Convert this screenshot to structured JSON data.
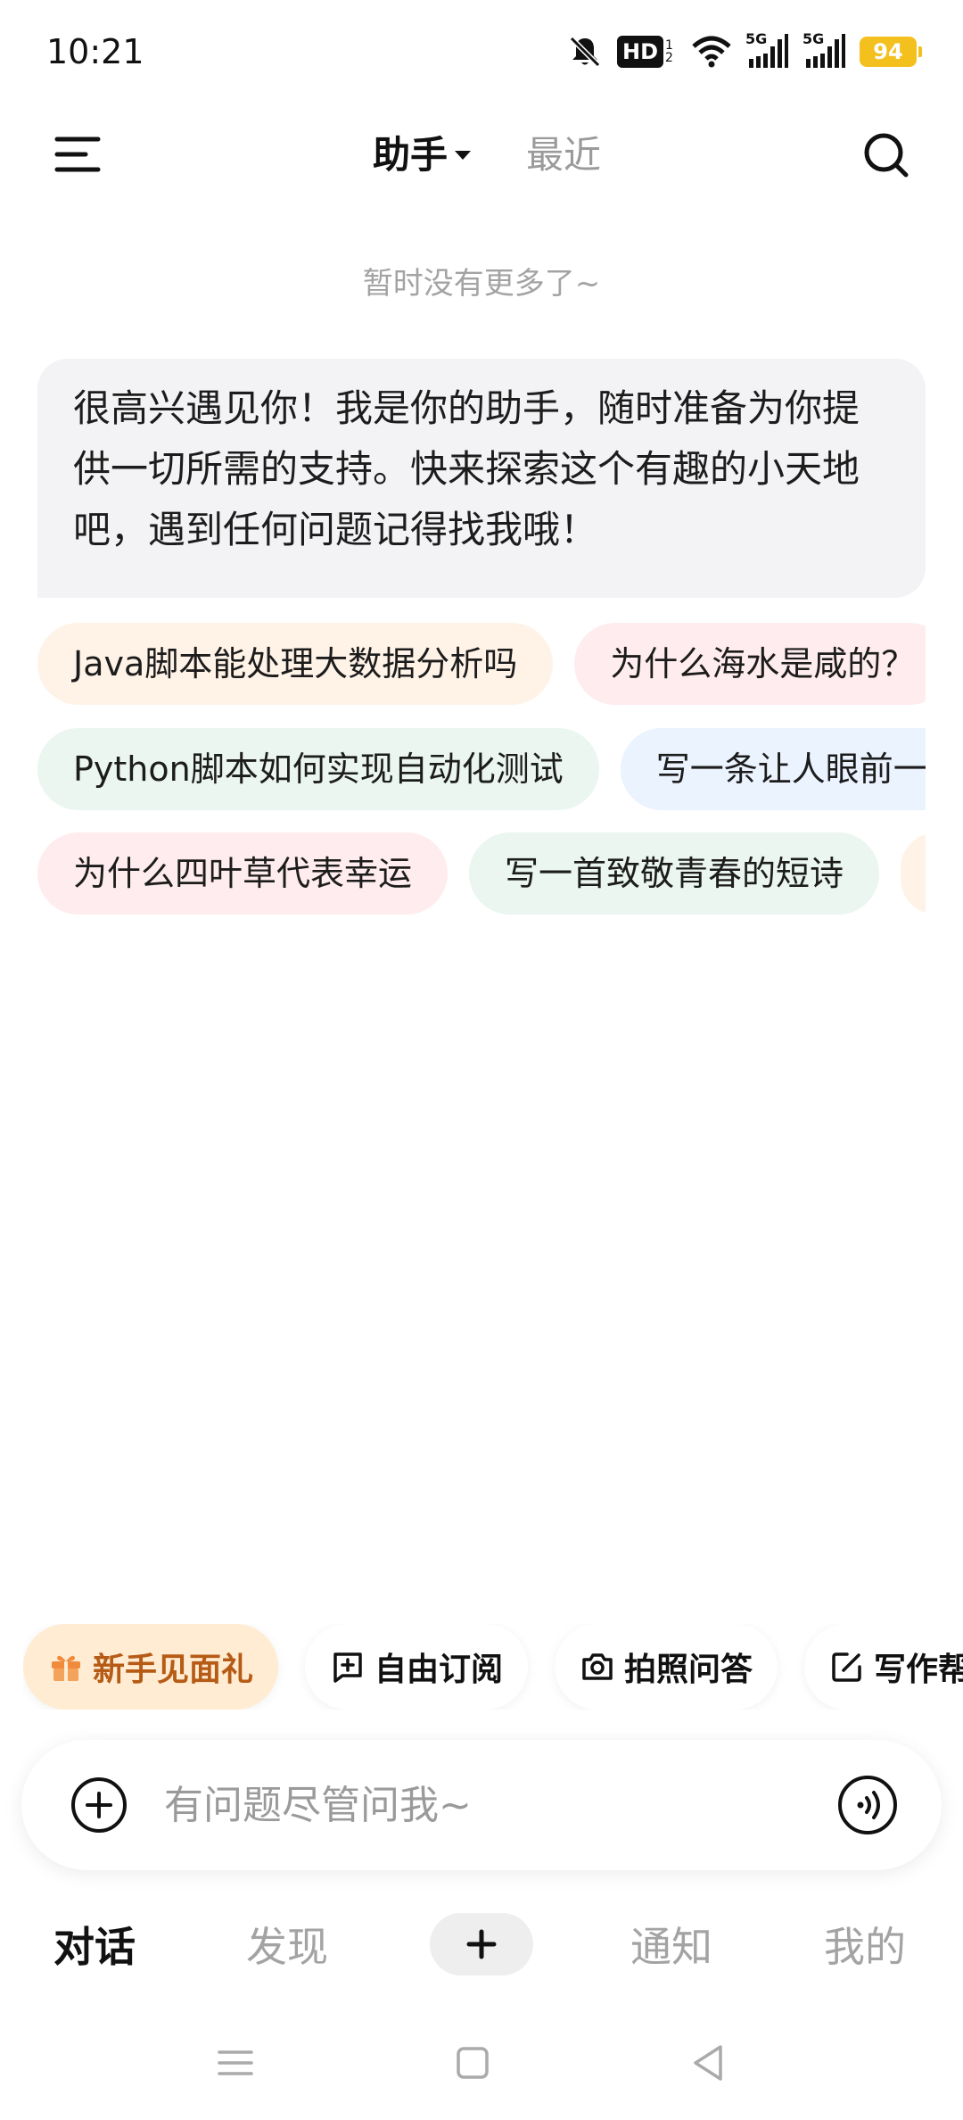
{
  "status_bar": {
    "time": "10:21",
    "hd_label": "HD",
    "hd_sup": "1 2",
    "net1": "5G",
    "net2": "5G",
    "battery": "94"
  },
  "header": {
    "tab_assistant": "助手",
    "tab_recent": "最近"
  },
  "no_more_text": "暂时没有更多了~",
  "welcome_message": "很高兴遇见你！我是你的助手，随时准备为你提供一切所需的支持。快来探索这个有趣的小天地吧，遇到任何问题记得找我哦！",
  "suggestions": {
    "row1": [
      "Java脚本能处理大数据分析吗",
      "为什么海水是咸的？"
    ],
    "row2": [
      "Python脚本如何实现自动化测试",
      "写一条让人眼前一亮的文案"
    ],
    "row3": [
      "为什么四叶草代表幸运",
      "写一首致敬青春的短诗",
      ""
    ]
  },
  "quick_actions": {
    "gift": "新手见面礼",
    "subscribe": "自由订阅",
    "photo_qa": "拍照问答",
    "writing": "写作帮手"
  },
  "input": {
    "placeholder": "有问题尽管问我~",
    "value": ""
  },
  "bottom_nav": {
    "chat": "对话",
    "discover": "发现",
    "notify": "通知",
    "mine": "我的"
  },
  "colors": {
    "battery": "#f4c01e",
    "gift_bg": "#ffecd2",
    "gift_text": "#b65b16"
  }
}
